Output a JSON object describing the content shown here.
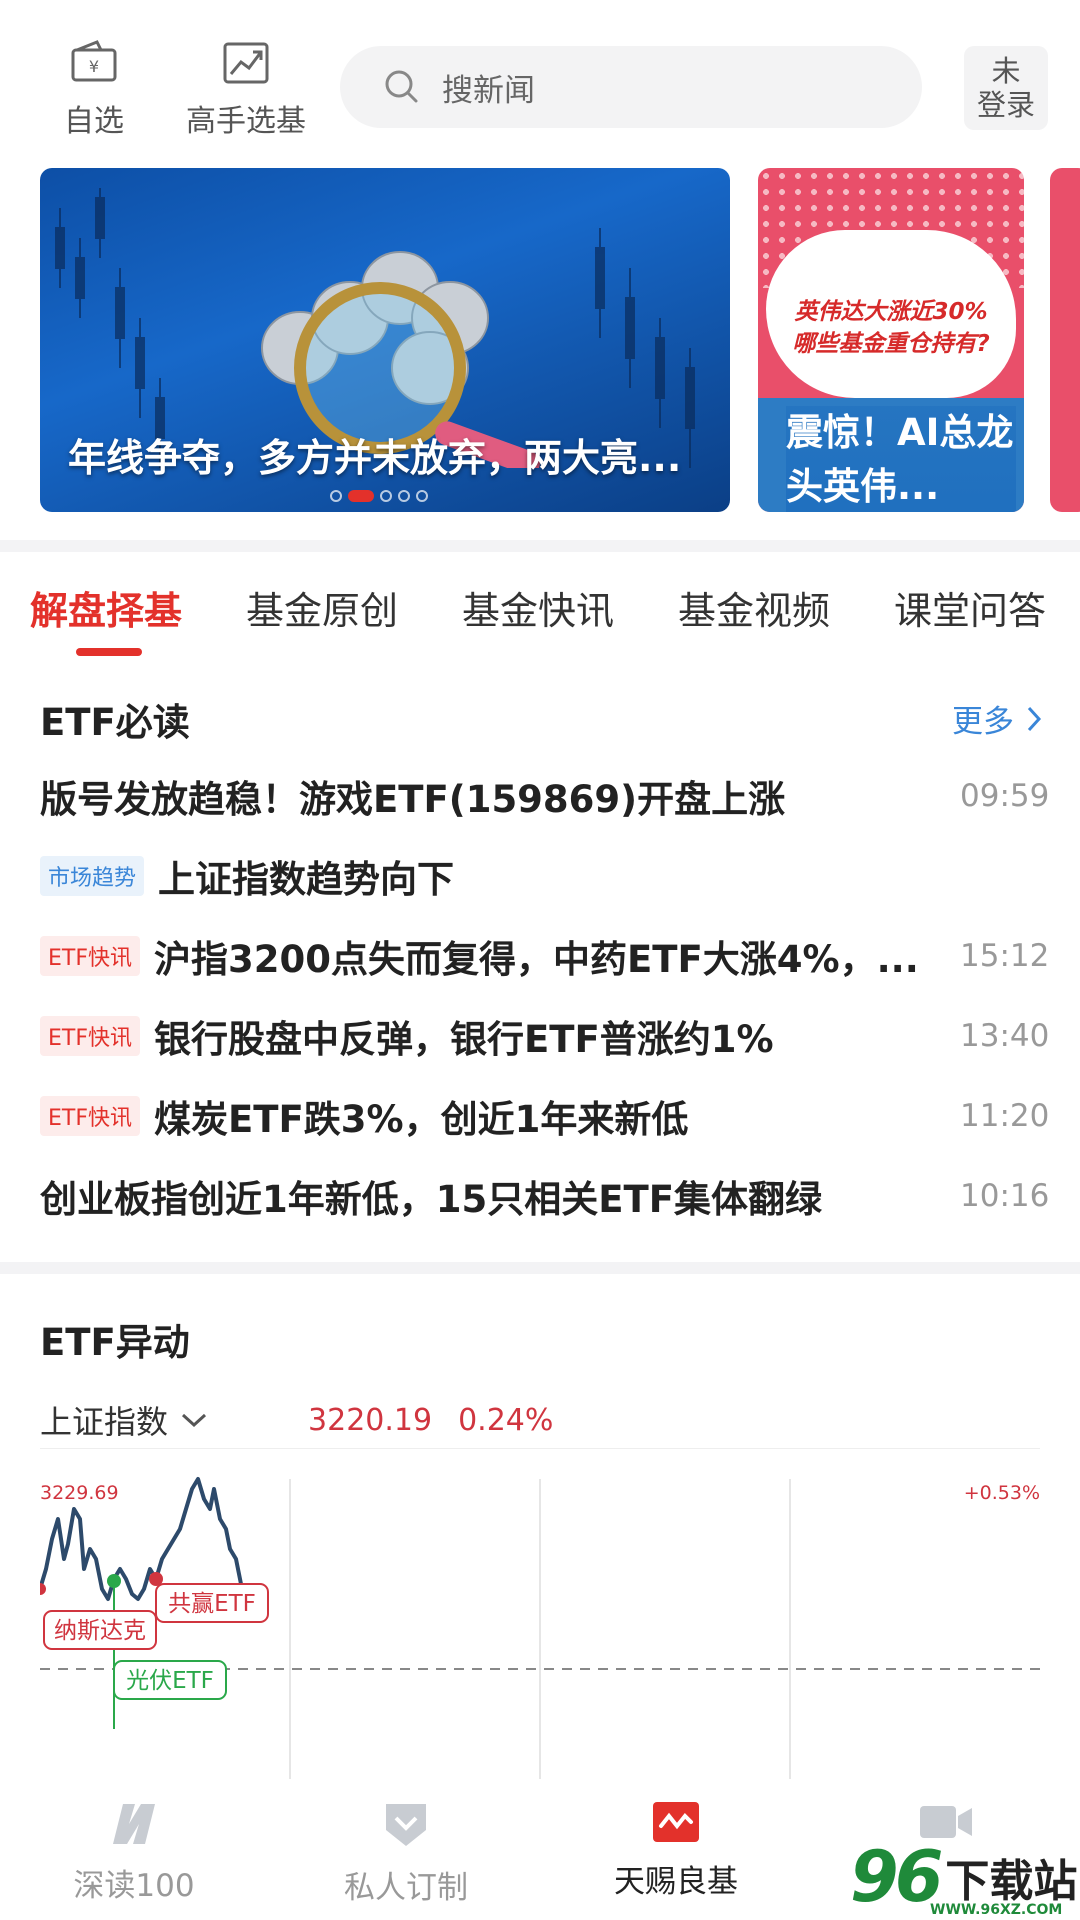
{
  "top": {
    "watchlist_label": "自选",
    "expert_label": "高手选基",
    "search_placeholder": "搜新闻",
    "login_line1": "未",
    "login_line2": "登录"
  },
  "banners": {
    "main_title": "年线争夺，多方并未放弃，两大亮...",
    "side_promo_line1": "英伟达大涨近30%",
    "side_promo_line2": "哪些基金重仓持有?",
    "side_title": "震惊！AI总龙头英伟..."
  },
  "tabs": [
    "解盘择基",
    "基金原创",
    "基金快讯",
    "基金视频",
    "课堂问答"
  ],
  "must_read": {
    "title": "ETF必读",
    "more_label": "更多",
    "items": [
      {
        "tag": "",
        "tag_type": "",
        "text": "版号发放趋稳！游戏ETF(159869)开盘上涨",
        "time": "09:59"
      },
      {
        "tag": "市场趋势",
        "tag_type": "blue",
        "text": "上证指数趋势向下",
        "time": ""
      },
      {
        "tag": "ETF快讯",
        "tag_type": "red",
        "text": "沪指3200点失而复得，中药ETF大涨4%，...",
        "time": "15:12"
      },
      {
        "tag": "ETF快讯",
        "tag_type": "red",
        "text": "银行股盘中反弹，银行ETF普涨约1%",
        "time": "13:40"
      },
      {
        "tag": "ETF快讯",
        "tag_type": "red",
        "text": "煤炭ETF跌3%，创近1年来新低",
        "time": "11:20"
      },
      {
        "tag": "",
        "tag_type": "",
        "text": "创业板指创近1年新低，15只相关ETF集体翻绿",
        "time": "10:16"
      }
    ]
  },
  "movement": {
    "title": "ETF异动",
    "index_name": "上证指数",
    "index_value": "3220.19",
    "index_change": "0.24%",
    "chart_high": "3229.69",
    "chart_high_pct": "+0.53%",
    "labels": {
      "nasdaq": "纳斯达克",
      "gongying": "共赢ETF",
      "guangfu": "光伏ETF"
    },
    "colors": {
      "line": "#2d4a6b",
      "up": "#d0353f",
      "down": "#2aa84a"
    }
  },
  "nav": {
    "items": [
      "深读100",
      "私人订制",
      "天赐良基",
      ""
    ],
    "active_index": 2
  },
  "watermark": {
    "number": "96",
    "text": "下载站",
    "url": "WWW.96XZ.COM"
  }
}
